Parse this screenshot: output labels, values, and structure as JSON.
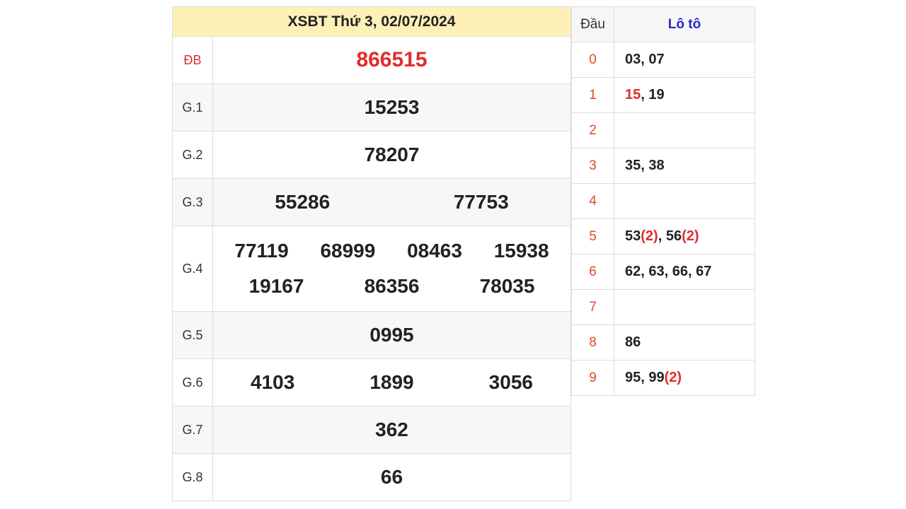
{
  "result_table": {
    "title": "XSBT Thứ 3, 02/07/2024",
    "rows": [
      {
        "label": "ĐB",
        "numbers": [
          "866515"
        ]
      },
      {
        "label": "G.1",
        "numbers": [
          "15253"
        ]
      },
      {
        "label": "G.2",
        "numbers": [
          "78207"
        ]
      },
      {
        "label": "G.3",
        "numbers": [
          "55286",
          "77753"
        ]
      },
      {
        "label": "G.4",
        "numbers": [
          "77119",
          "68999",
          "08463",
          "15938",
          "19167",
          "86356",
          "78035"
        ]
      },
      {
        "label": "G.5",
        "numbers": [
          "0995"
        ]
      },
      {
        "label": "G.6",
        "numbers": [
          "4103",
          "1899",
          "3056"
        ]
      },
      {
        "label": "G.7",
        "numbers": [
          "362"
        ]
      },
      {
        "label": "G.8",
        "numbers": [
          "66"
        ]
      }
    ]
  },
  "loto_table": {
    "header_dau": "Đầu",
    "header_loto": "Lô tô",
    "rows": [
      {
        "dau": "0",
        "parts": [
          {
            "t": "03, 07",
            "red": false
          }
        ]
      },
      {
        "dau": "1",
        "parts": [
          {
            "t": "15",
            "red": true
          },
          {
            "t": ", 19",
            "red": false
          }
        ]
      },
      {
        "dau": "2",
        "parts": []
      },
      {
        "dau": "3",
        "parts": [
          {
            "t": "35, 38",
            "red": false
          }
        ]
      },
      {
        "dau": "4",
        "parts": []
      },
      {
        "dau": "5",
        "parts": [
          {
            "t": "53",
            "red": false
          },
          {
            "t": "(2)",
            "red": true
          },
          {
            "t": ", 56",
            "red": false
          },
          {
            "t": "(2)",
            "red": true
          }
        ]
      },
      {
        "dau": "6",
        "parts": [
          {
            "t": "62, 63, 66, 67",
            "red": false
          }
        ]
      },
      {
        "dau": "7",
        "parts": []
      },
      {
        "dau": "8",
        "parts": [
          {
            "t": "86",
            "red": false
          }
        ]
      },
      {
        "dau": "9",
        "parts": [
          {
            "t": "95, 99",
            "red": false
          },
          {
            "t": "(2)",
            "red": true
          }
        ]
      }
    ]
  },
  "colors": {
    "accent_red": "#e32b2b",
    "header_bg": "#fdf1b7",
    "loto_header": "#2828c8"
  }
}
